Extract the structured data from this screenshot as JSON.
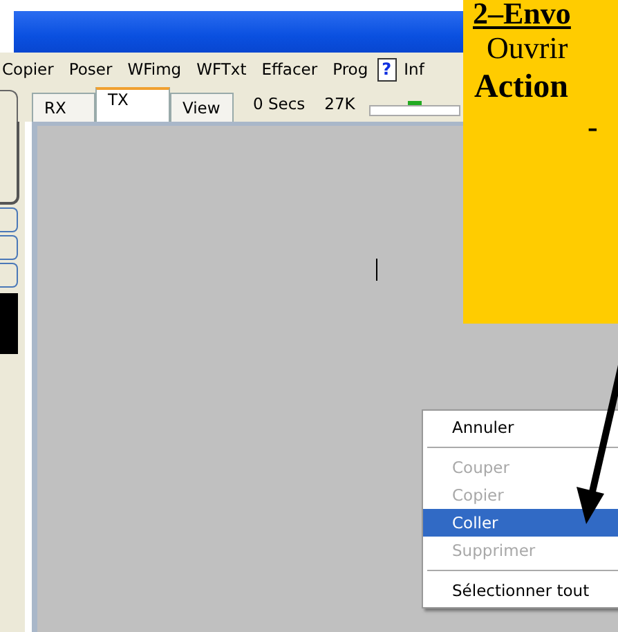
{
  "menu_bar": {
    "items": [
      {
        "label": "Copier"
      },
      {
        "label": "Poser"
      },
      {
        "label": "WFimg"
      },
      {
        "label": "WFTxt"
      },
      {
        "label": "Effacer"
      },
      {
        "label": "Prog"
      },
      {
        "label": "Inf",
        "kind": "help",
        "icon_text": "?"
      }
    ]
  },
  "tabs": [
    {
      "label": "RX",
      "selected": false
    },
    {
      "label": "TX",
      "selected": true
    },
    {
      "label": "View",
      "selected": false
    }
  ],
  "status": {
    "time": "0 Secs",
    "size": "27K",
    "slider": {
      "level": 0.5
    }
  },
  "context_menu": {
    "items": [
      {
        "kind": "item",
        "label": "Annuler",
        "disabled": false,
        "selected": false
      },
      {
        "kind": "separator"
      },
      {
        "kind": "item",
        "label": "Couper",
        "disabled": true,
        "selected": false
      },
      {
        "kind": "item",
        "label": "Copier",
        "disabled": true,
        "selected": false
      },
      {
        "kind": "item",
        "label": "Coller",
        "disabled": false,
        "selected": true
      },
      {
        "kind": "item",
        "label": "Supprimer",
        "disabled": true,
        "selected": false
      },
      {
        "kind": "separator"
      },
      {
        "kind": "item",
        "label": "Sélectionner tout",
        "disabled": false,
        "selected": false
      }
    ]
  },
  "callout": {
    "heading": "2–Envo",
    "line_1": "Ouvrir",
    "line_2": "Action",
    "line_3": "-"
  }
}
